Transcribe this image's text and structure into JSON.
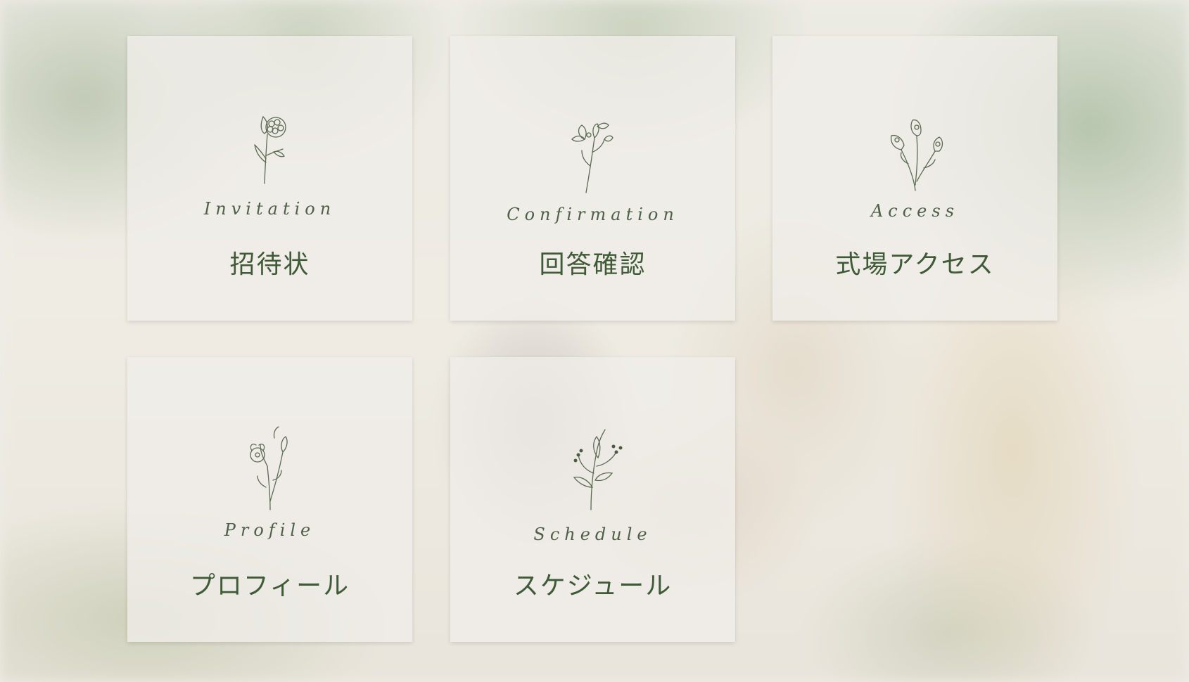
{
  "menu": {
    "invitation": {
      "script": "Invitation",
      "label": "招待状"
    },
    "confirmation": {
      "script": "Confirmation",
      "label": "回答確認"
    },
    "access": {
      "script": "Access",
      "label": "式場アクセス"
    },
    "profile": {
      "script": "Profile",
      "label": "プロフィール"
    },
    "schedule": {
      "script": "Schedule",
      "label": "スケジュール"
    }
  },
  "colors": {
    "text": "#3f5a36",
    "card": "#f0ede9",
    "line_art": "#5b6a52"
  }
}
